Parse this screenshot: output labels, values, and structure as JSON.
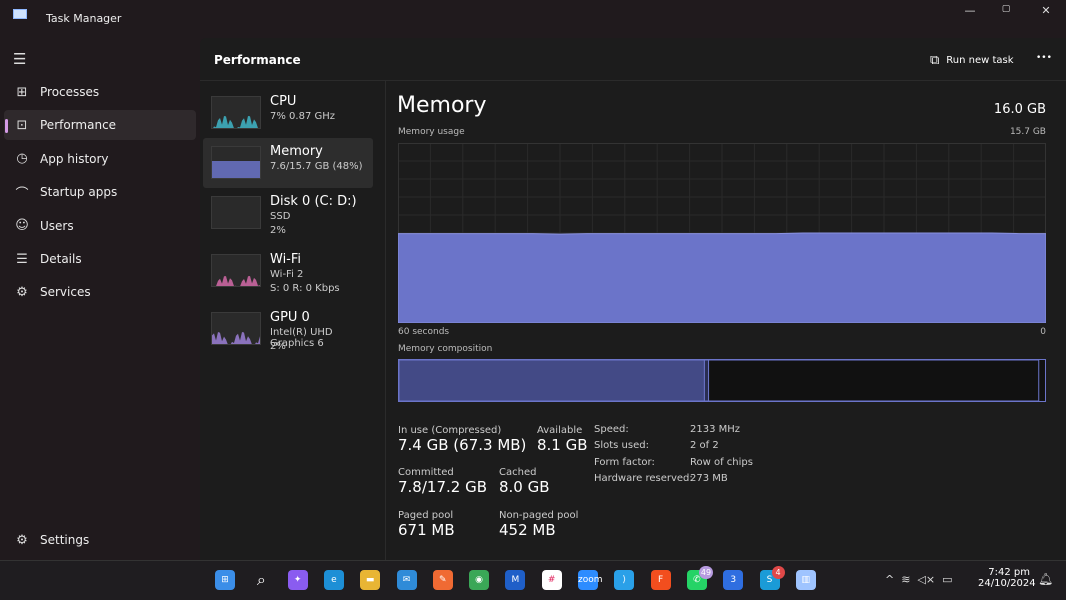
{
  "app": {
    "title": "Task Manager",
    "minimize": "—",
    "maximize": "▢",
    "close": "✕"
  },
  "sidebar": {
    "items": [
      {
        "label": "Processes",
        "icon": "processes-icon",
        "glyph": "⊞"
      },
      {
        "label": "Performance",
        "icon": "performance-icon",
        "glyph": "⊡"
      },
      {
        "label": "App history",
        "icon": "history-icon",
        "glyph": "◷"
      },
      {
        "label": "Startup apps",
        "icon": "startup-icon",
        "glyph": "⌒"
      },
      {
        "label": "Users",
        "icon": "users-icon",
        "glyph": "☺"
      },
      {
        "label": "Details",
        "icon": "details-icon",
        "glyph": "☰"
      },
      {
        "label": "Services",
        "icon": "services-icon",
        "glyph": "⚙"
      }
    ],
    "settings": "Settings",
    "active": "Performance"
  },
  "header": {
    "title": "Performance",
    "run_new_task": "Run new task",
    "more": "•••"
  },
  "devices": [
    {
      "name": "CPU",
      "line1": "7%  0.87 GHz",
      "line2": "",
      "color": "#3fb6c8"
    },
    {
      "name": "Memory",
      "line1": "7.6/15.7 GB (48%)",
      "line2": "",
      "color": "#6b74c9"
    },
    {
      "name": "Disk 0 (C: D:)",
      "line1": "SSD",
      "line2": "2%",
      "color": "#46a58c"
    },
    {
      "name": "Wi-Fi",
      "line1": "Wi-Fi 2",
      "line2": "S: 0  R: 0 Kbps",
      "color": "#d36aa8"
    },
    {
      "name": "GPU 0",
      "line1": "Intel(R) UHD Graphics 6",
      "line2": "2%",
      "color": "#9b7fd6"
    }
  ],
  "detail": {
    "title": "Memory",
    "total": "16.0 GB",
    "usage_label": "Memory usage",
    "usage_max": "15.7 GB",
    "x_left": "60 seconds",
    "x_right": "0",
    "composition_label": "Memory composition",
    "accent": "#6b74c9",
    "usage_history_gb": [
      7.8,
      7.8,
      7.8,
      7.8,
      7.8,
      7.8,
      7.75,
      7.8,
      7.8,
      7.8,
      7.8,
      7.8,
      7.8,
      7.8,
      7.8,
      7.85,
      7.85,
      7.85,
      7.85,
      7.85,
      7.85,
      7.85,
      7.85,
      7.8,
      7.8
    ],
    "composition": {
      "in_use_gb": 7.4,
      "modified_gb": 0.1,
      "standby_gb": 8.0,
      "free_gb": 0.3,
      "total_gb": 15.7
    },
    "stats": [
      {
        "label": "In use (Compressed)",
        "value": "7.4 GB (67.3 MB)"
      },
      {
        "label": "Available",
        "value": "8.1 GB"
      },
      {
        "label": "Committed",
        "value": "7.8/17.2 GB"
      },
      {
        "label": "Cached",
        "value": "8.0 GB"
      },
      {
        "label": "Paged pool",
        "value": "671 MB"
      },
      {
        "label": "Non-paged pool",
        "value": "452 MB"
      }
    ],
    "specs": [
      {
        "label": "Speed:",
        "value": "2133 MHz"
      },
      {
        "label": "Slots used:",
        "value": "2 of 2"
      },
      {
        "label": "Form factor:",
        "value": "Row of chips"
      },
      {
        "label": "Hardware reserved:",
        "value": "273 MB"
      }
    ]
  },
  "taskbar": {
    "apps": [
      {
        "name": "start",
        "glyph": "⊞",
        "color": "#3b8ee8"
      },
      {
        "name": "search",
        "glyph": "⌕",
        "color": "transparent"
      },
      {
        "name": "copilot",
        "glyph": "✦",
        "color": "#8a5cf0"
      },
      {
        "name": "edge",
        "glyph": "e",
        "color": "#1d8fd6"
      },
      {
        "name": "file-explorer",
        "glyph": "▬",
        "color": "#e8b534"
      },
      {
        "name": "mail",
        "glyph": "✉",
        "color": "#2f8bd8"
      },
      {
        "name": "postman",
        "glyph": "✎",
        "color": "#f06a33"
      },
      {
        "name": "chrome",
        "glyph": "◉",
        "color": "#3aa757"
      },
      {
        "name": "coinmarketcap",
        "glyph": "M",
        "color": "#1f5fc8"
      },
      {
        "name": "slack",
        "glyph": "#",
        "color": "#ffffff"
      },
      {
        "name": "zoom",
        "glyph": "zoom",
        "color": "#2d8cff"
      },
      {
        "name": "vscode",
        "glyph": "⟩",
        "color": "#2aa0e8"
      },
      {
        "name": "figma",
        "glyph": "F",
        "color": "#f24e1e"
      },
      {
        "name": "whatsapp",
        "glyph": "✆",
        "color": "#25d366",
        "badge": "49"
      },
      {
        "name": "app-3",
        "glyph": "3",
        "color": "#2f6ee0"
      },
      {
        "name": "skype",
        "glyph": "S",
        "color": "#1a9bd7",
        "badge": "4"
      },
      {
        "name": "task-manager",
        "glyph": "▥",
        "color": "#9fc4ff"
      }
    ],
    "time": "7:42 pm",
    "date": "24/10/2024",
    "tray": "^  ≋  ◁×  ▭"
  }
}
